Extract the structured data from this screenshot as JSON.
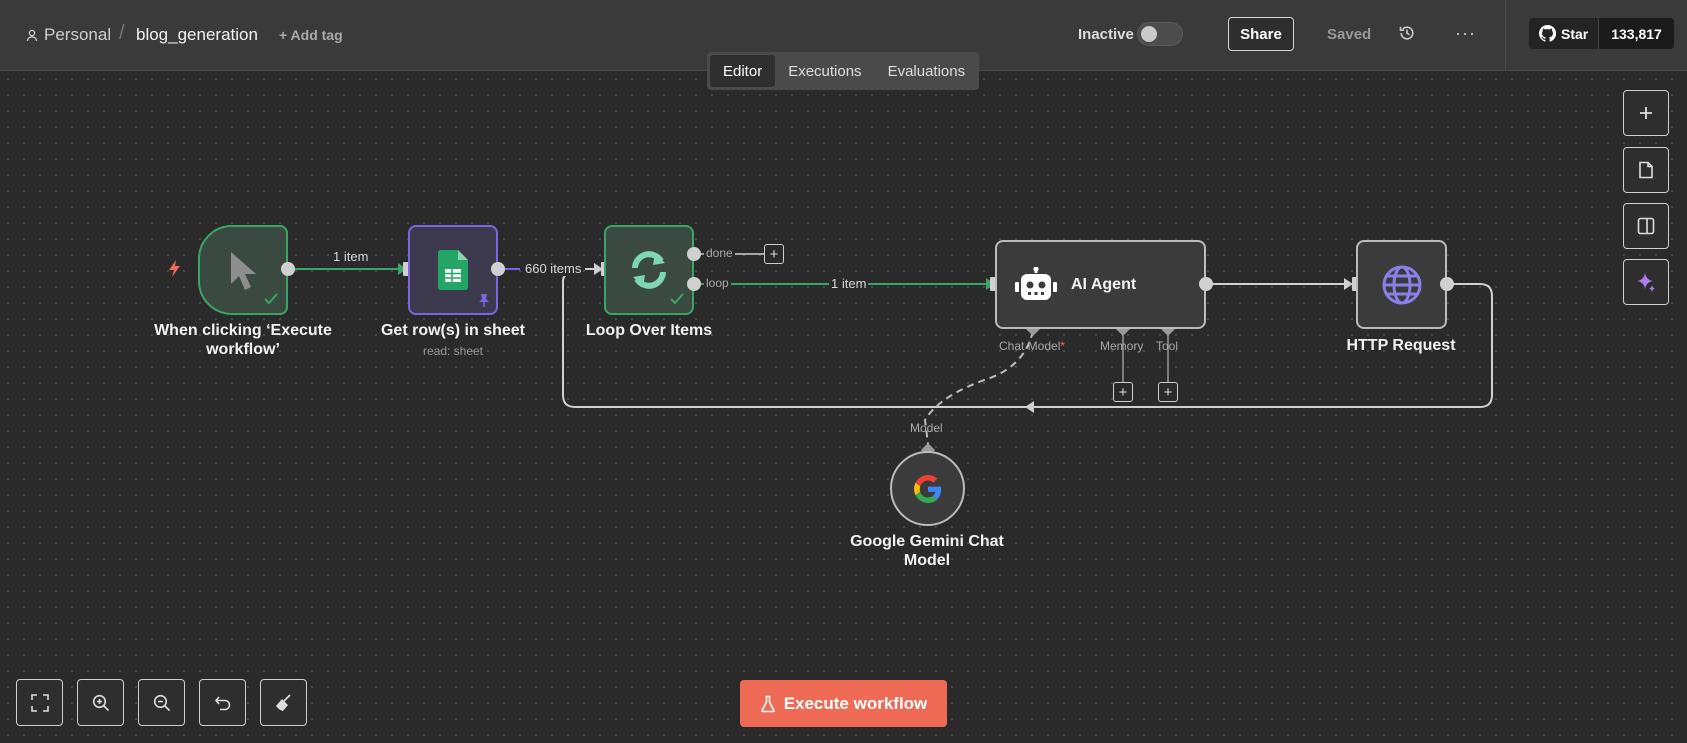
{
  "header": {
    "project": "Personal",
    "separator": "/",
    "workflow_name": "blog_generation",
    "add_tag": "+ Add tag",
    "status_label": "Inactive",
    "share_label": "Share",
    "saved_label": "Saved",
    "more_label": "···",
    "github_star_label": "Star",
    "github_star_count": "133,817"
  },
  "tabs": [
    {
      "label": "Editor",
      "active": true
    },
    {
      "label": "Executions",
      "active": false
    },
    {
      "label": "Evaluations",
      "active": false
    }
  ],
  "nodes": {
    "trigger": {
      "title": "When clicking ‘Execute workflow’",
      "icon": "cursor-icon"
    },
    "sheet": {
      "title": "Get row(s) in sheet",
      "subtitle": "read: sheet",
      "icon": "google-sheets-icon"
    },
    "loop": {
      "title": "Loop Over Items",
      "icon": "loop-icon"
    },
    "agent": {
      "title": "AI Agent",
      "icon": "robot-icon"
    },
    "http": {
      "title": "HTTP Request",
      "icon": "globe-icon"
    },
    "gemini": {
      "title": "Google Gemini Chat Model",
      "icon": "google-icon"
    }
  },
  "edges": {
    "trigger_to_sheet": "1 item",
    "sheet_to_loop": "660 items",
    "loop_done": "done",
    "loop_loop": "loop",
    "loop_to_agent": "1 item"
  },
  "agent_ports": {
    "chat_model": "Chat Model",
    "required_mark": "*",
    "memory": "Memory",
    "tool": "Tool"
  },
  "gemini_port": "Model",
  "toolbar": {
    "execute_label": "Execute workflow"
  },
  "colors": {
    "accent": "#ee6a55",
    "success": "#3aa565",
    "purple": "#7a66e0",
    "loop_icon": "#7fd6b4",
    "globe": "#8b7fe8"
  }
}
